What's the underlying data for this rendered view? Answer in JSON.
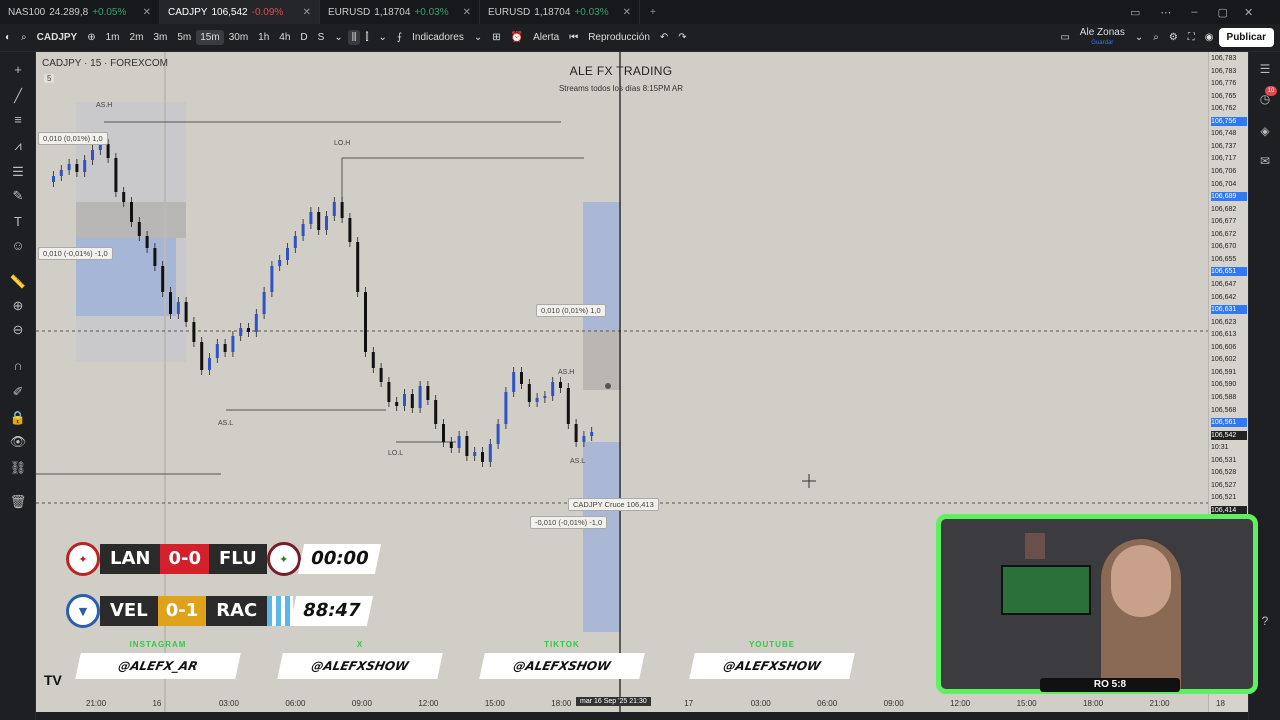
{
  "tabs": [
    {
      "symbol": "NAS100",
      "price": "24.289,8",
      "change": "+0.05%",
      "dir": "up"
    },
    {
      "symbol": "CADJPY",
      "price": "106,542",
      "change": "-0.09%",
      "dir": "dn"
    },
    {
      "symbol": "EURUSD",
      "price": "1,18704",
      "change": "+0.03%",
      "dir": "up"
    },
    {
      "symbol": "EURUSD",
      "price": "1,18704",
      "change": "+0.03%",
      "dir": "up"
    }
  ],
  "toolbar": {
    "symbol": "CADJPY",
    "intervals": [
      "1m",
      "2m",
      "3m",
      "5m",
      "15m",
      "30m",
      "1h",
      "4h",
      "D",
      "S"
    ],
    "selected_interval": "15m",
    "indicators": "Indicadores",
    "alert": "Alerta",
    "replay": "Reproducción",
    "user": "Ale Zonas",
    "user_sub": "Guardar",
    "publish": "Publicar"
  },
  "chart": {
    "symbol_line": "CADJPY · 15 · FOREXCOM",
    "sub_badge": "5",
    "brand_title": "ALE FX TRADING",
    "brand_sub": "Streams todos los días 8:15PM AR",
    "labels": {
      "ash_top": "AS.H",
      "loh": "LO.H",
      "asl": "AS.L",
      "lol": "LO.L",
      "ash_right": "AS.H",
      "asl_right": "AS.L"
    },
    "tags": {
      "t1": "0,010 (0,01%) 1,0",
      "t2": "0,010 (-0,01%) -1,0",
      "t3": "0,010 (0,01%) 1,0",
      "t4": "-0,010 (-0,01%) -1,0",
      "cross": "CADJPY Cruce 106,413"
    }
  },
  "price_axis": [
    "106,783",
    "106,783",
    "106,776",
    "106,765",
    "106,762",
    "106,756",
    "106,748",
    "106,737",
    "106,717",
    "106,706",
    "106,704",
    "106,689",
    "106,682",
    "106,677",
    "106,672",
    "106,670",
    "106,655",
    "106,651",
    "106,647",
    "106,642",
    "106,631",
    "106,623",
    "106,613",
    "106,606",
    "106,602",
    "106,591",
    "106,590",
    "106,588",
    "106,568",
    "106,561",
    "106,542",
    "10:31",
    "106,531",
    "106,528",
    "106,527",
    "106,521",
    "106,414"
  ],
  "price_axis_highlight": [
    "106,756",
    "106,689",
    "106,651",
    "106,631",
    "106,561"
  ],
  "price_axis_dark": [
    "106,542",
    "106,414"
  ],
  "time_axis": [
    "21:00",
    "16",
    "03:00",
    "06:00",
    "09:00",
    "12:00",
    "15:00",
    "18:00",
    "21:30",
    "17",
    "03:00",
    "06:00",
    "09:00",
    "12:00",
    "15:00",
    "18:00",
    "21:00",
    "18"
  ],
  "crosshair_date": "mar 16 Sep '25",
  "crosshair_time": "21:30",
  "scores": [
    {
      "home": "LAN",
      "result": "0-0",
      "away": "FLU",
      "clock": "00:00",
      "result_color": "#d4202a"
    },
    {
      "home": "VEL",
      "result": "0-1",
      "away": "RAC",
      "clock": "88:47",
      "result_color": "#e0a21a"
    }
  ],
  "socials": [
    {
      "platform": "INSTAGRAM",
      "handle": "@ALEFX_AR"
    },
    {
      "platform": "X",
      "handle": "@ALEFXSHOW"
    },
    {
      "platform": "TIKTOK",
      "handle": "@ALEFXSHOW"
    },
    {
      "platform": "YOUTUBE",
      "handle": "@ALEFXSHOW"
    }
  ],
  "camera_label": "RO 5:8",
  "notification_count": "10",
  "colors": {
    "accent": "#3178f6",
    "cam_border": "#5ef05e",
    "bull": "#2f52c4",
    "bear": "#111111"
  }
}
